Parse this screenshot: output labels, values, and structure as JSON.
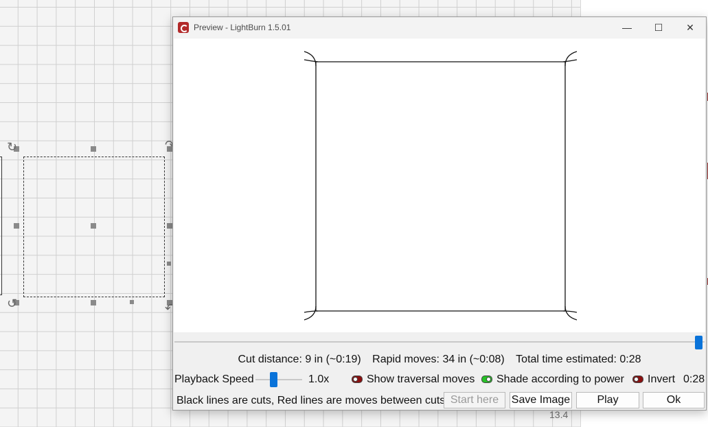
{
  "window": {
    "title": "Preview - LightBurn 1.5.01",
    "controls": {
      "minimize": "—",
      "maximize": "☐",
      "close": "✕"
    }
  },
  "stats": {
    "cut_distance": "Cut distance: 9 in (~0:19)",
    "rapid_moves": "Rapid moves: 34 in (~0:08)",
    "total_time": "Total time estimated: 0:28"
  },
  "playback": {
    "label": "Playback Speed",
    "speed_value": "1.0x",
    "toggles": [
      {
        "label": "Show traversal moves",
        "state": "off"
      },
      {
        "label": "Shade according to power",
        "state": "on"
      },
      {
        "label": "Invert",
        "state": "off"
      }
    ],
    "time_readout": "0:28"
  },
  "footer": {
    "note": "Black lines are cuts, Red lines are moves between cuts",
    "buttons": {
      "start_here": "Start here",
      "save_image": "Save Image",
      "play": "Play",
      "ok": "Ok"
    }
  },
  "background": {
    "readout": "13.4"
  },
  "colors": {
    "accent": "#0a73d9",
    "toggle_off": "#8b1010",
    "toggle_on": "#27c227",
    "app_icon": "#b22a2a"
  },
  "icons": [
    "app-logo-icon",
    "minimize-icon",
    "maximize-icon",
    "close-icon",
    "rotate-handle-icon"
  ]
}
